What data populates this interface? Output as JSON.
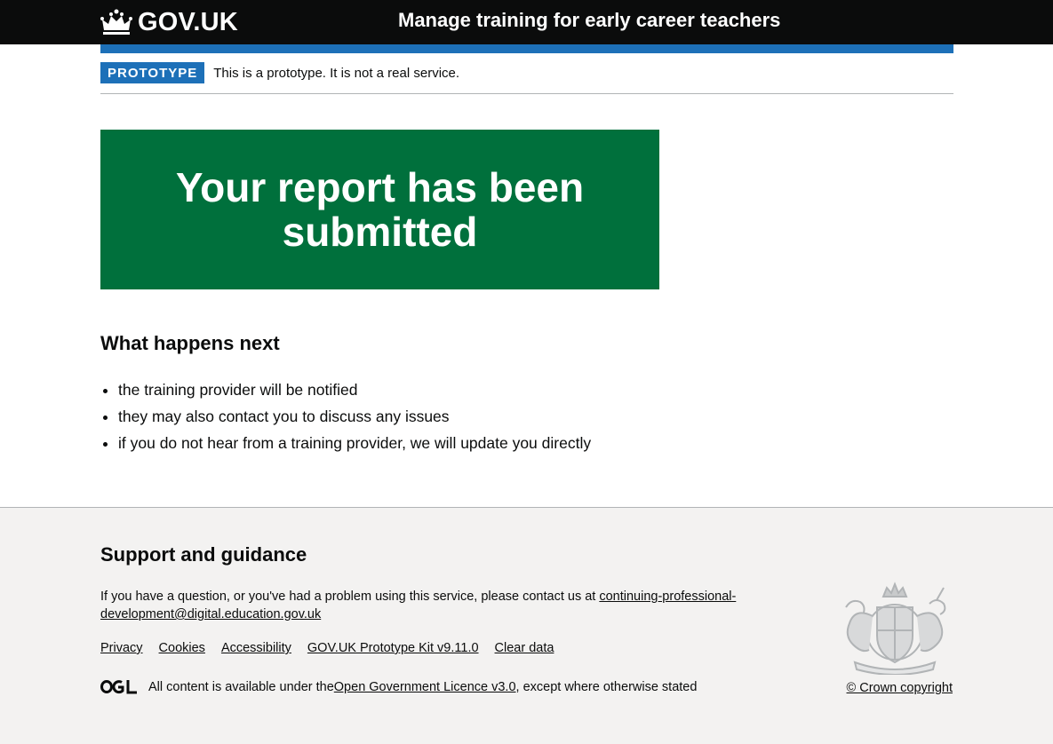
{
  "header": {
    "logo_text": "GOV.UK",
    "service_name": "Manage training for early career teachers"
  },
  "phase_banner": {
    "tag": "PROTOTYPE",
    "text": "This is a prototype. It is not a real service."
  },
  "confirmation": {
    "title": "Your report has been submitted"
  },
  "next": {
    "heading": "What happens next",
    "items": [
      "the training provider will be notified",
      "they may also contact you to discuss any issues",
      "if you do not hear from a training provider, we will update you directly"
    ]
  },
  "footer": {
    "heading": "Support and guidance",
    "support_text": "If you have a question, or you've had a problem using this service, please contact us at ",
    "support_email": "continuing-professional-development@digital.education.gov.uk",
    "links": [
      "Privacy",
      "Cookies",
      "Accessibility",
      "GOV.UK Prototype Kit v9.11.0",
      "Clear data"
    ],
    "licence_prefix": "All content is available under the ",
    "licence_link": "Open Government Licence v3.0",
    "licence_suffix": ", except where otherwise stated",
    "copyright": "© Crown copyright"
  },
  "colors": {
    "header": "#0b0c0c",
    "brand_blue": "#1d70b8",
    "success_green": "#00703c",
    "footer_bg": "#f3f2f1"
  }
}
